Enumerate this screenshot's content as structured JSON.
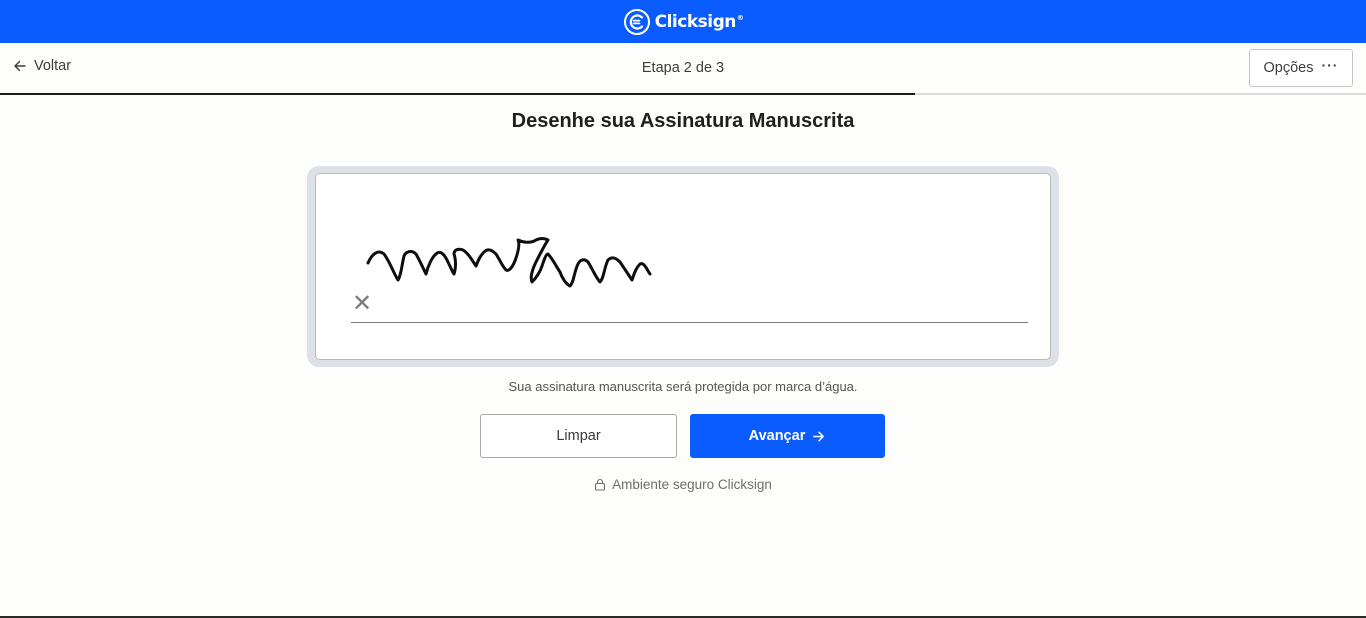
{
  "brand": {
    "name": "Clicksign",
    "mark": "®",
    "icon": "clicksign-logo-icon",
    "color": "#0a5cff"
  },
  "nav": {
    "back_label": "Voltar",
    "back_icon": "arrow-left-icon",
    "step_label": "Etapa 2 de 3",
    "options_label": "Opções",
    "options_icon": "more-dots-icon",
    "progress": 0.67
  },
  "page": {
    "title": "Desenhe sua Assinatura Manuscrita"
  },
  "signature_pad": {
    "clear_mark": "✕",
    "watermark_note": "Sua assinatura manuscrita será protegida por marca d’água."
  },
  "actions": {
    "clear_label": "Limpar",
    "next_label": "Avançar",
    "next_icon": "arrow-right-icon"
  },
  "footer": {
    "secure_label": "Ambiente seguro Clicksign",
    "secure_icon": "lock-icon"
  }
}
